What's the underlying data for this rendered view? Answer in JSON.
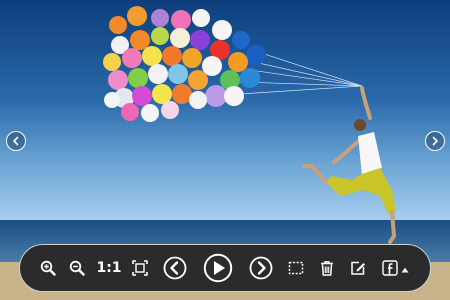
{
  "viewer": {
    "zoom_actual_label": "1:1"
  },
  "icons": {
    "zoom_in": "zoom-in-icon",
    "zoom_out": "zoom-out-icon",
    "fit": "fit-to-screen-icon",
    "prev": "chevron-left-icon",
    "play": "play-icon",
    "next": "chevron-right-icon",
    "select": "selection-icon",
    "delete": "trash-icon",
    "edit": "edit-icon",
    "share": "facebook-icon",
    "share_menu": "triangle-up-icon"
  },
  "colors": {
    "toolbar_bg": "#2b2b2b",
    "toolbar_border": "#cfcfcf",
    "icon": "#ffffff"
  }
}
